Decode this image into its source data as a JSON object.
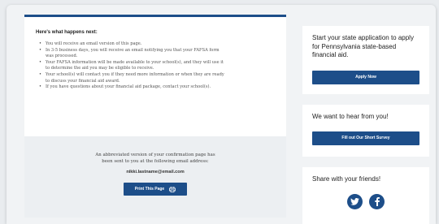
{
  "main": {
    "title": "Here's what happens next:",
    "bullets": [
      "You will receive an email version of this page.",
      "In 3-5 business days, you will receive an email notifying you that your FAFSA form",
      "was processed.",
      "Your FAFSA information will be made available to your school(s), and they will use it",
      "to determine the aid you may be eligible to receive.",
      "Your school(s) will contact you if they need more information or when they are ready",
      "to discuss your financial aid award.",
      "If you have questions about your financial aid package, contact your school(s)."
    ]
  },
  "confirmation": {
    "text": "An abbreviated version of your confirmation page has been sent to you at the following email address:",
    "email": "nikki.lastname@email.com",
    "print_label": "Print This Page",
    "print_icon": "printer-icon"
  },
  "sidebar": {
    "state_app": {
      "text": "Start your state application to apply for Pennsylvania state-based financial aid.",
      "button": "Apply Now"
    },
    "survey": {
      "text": "We want to hear from you!",
      "button": "Fill out Our Short Survey"
    },
    "share": {
      "text": "Share with your friends!",
      "icons": [
        "twitter-icon",
        "facebook-icon"
      ]
    }
  },
  "colors": {
    "brand": "#1d4e89",
    "background": "#f1f3f5"
  }
}
